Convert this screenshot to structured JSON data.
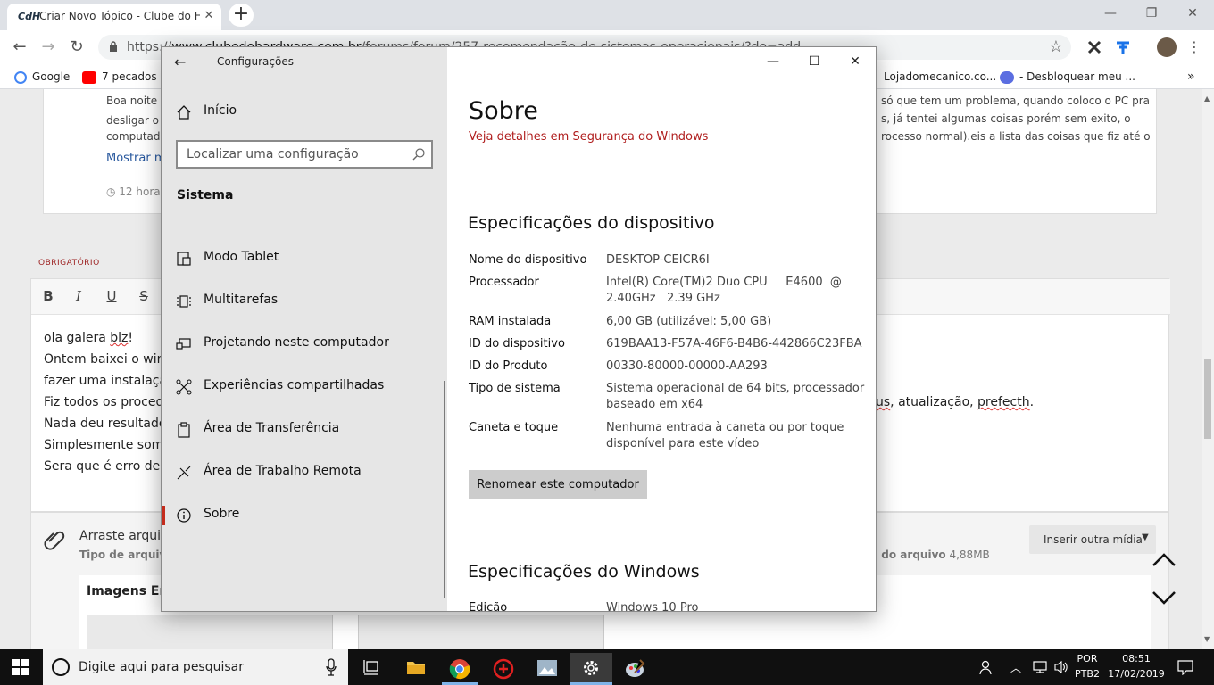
{
  "browser": {
    "tab_title": "Criar Novo Tópico - Clube do Ha",
    "tab_favicon_text": "CdH",
    "url_prefix": "https://",
    "url_domain": "www.clubedohardware.com.br",
    "url_path": "/forums/forum/257-recomendação-de-sistemas-operacionais/?do=add",
    "bookmarks": [
      {
        "label": "Google",
        "color": "#4285f4"
      },
      {
        "label": "7 pecados d",
        "color": "#ff0000"
      },
      {
        "label": "Lojadomecanico.co...",
        "color": "#e8e8e8"
      },
      {
        "label": "- Desbloquear meu ...",
        "color": "#5b6ee1"
      }
    ],
    "bookmarks_more": "»"
  },
  "page": {
    "post_line1": "Boa noite",
    "post_line2": "desligar o v",
    "post_line3": "computad",
    "post_right1": "só que tem um problema, quando coloco o PC pra",
    "post_right2": "s, já tentei algumas coisas porém sem exito, o",
    "post_right3": "rocesso normal).eis a lista das coisas que fiz até o",
    "show_more": "Mostrar ma",
    "time_ago": "12 horas",
    "required_label": "OBRIGATÓRIO",
    "format_buttons": [
      "B",
      "I",
      "U",
      "S"
    ],
    "editor_lines": [
      "ola galera ",
      "Ontem baixei o wind",
      "fazer uma instalaçã",
      "Fiz todos os procedi",
      "Nada deu resultado.",
      "Simplesmente some",
      "Sera que é erro des"
    ],
    "editor_word_blz": "blz",
    "editor_word_exclaim": "!",
    "editor_right_a": "us",
    "editor_right_b": ", atualização, ",
    "editor_right_c": "prefecth",
    "editor_right_d": ".",
    "attach_drag": "Arraste arquivo",
    "attach_types": "Tipo de arquiv",
    "attach_size_label": "l do arquivo",
    "attach_size_value": "4,88MB",
    "insert_media": "Inserir outra mídia",
    "images_heading": "Imagens Env"
  },
  "settings": {
    "app_title": "Configurações",
    "home": "Início",
    "search_placeholder": "Localizar uma configuração",
    "section": "Sistema",
    "nav": [
      {
        "label": "Modo Tablet",
        "icon": "tablet-mode-icon"
      },
      {
        "label": "Multitarefas",
        "icon": "multitasking-icon"
      },
      {
        "label": "Projetando neste computador",
        "icon": "projecting-icon"
      },
      {
        "label": "Experiências compartilhadas",
        "icon": "shared-experiences-icon"
      },
      {
        "label": "Área de Transferência",
        "icon": "clipboard-icon"
      },
      {
        "label": "Área de Trabalho Remota",
        "icon": "remote-desktop-icon"
      },
      {
        "label": "Sobre",
        "icon": "info-icon"
      }
    ],
    "accent": "#c42b1c",
    "about": {
      "title": "Sobre",
      "security_link": "Veja detalhes em Segurança do Windows",
      "device_specs_heading": "Especificações do dispositivo",
      "specs": [
        {
          "key": "Nome do dispositivo",
          "value": "DESKTOP-CEICR6I"
        },
        {
          "key": "Processador",
          "value": "Intel(R) Core(TM)2 Duo CPU     E4600  @ 2.40GHz   2.39 GHz"
        },
        {
          "key": "RAM instalada",
          "value": "6,00 GB (utilizável: 5,00 GB)"
        },
        {
          "key": "ID do dispositivo",
          "value": "619BAA13-F57A-46F6-B4B6-442866C23FBA"
        },
        {
          "key": "ID do Produto",
          "value": "00330-80000-00000-AA293"
        },
        {
          "key": "Tipo de sistema",
          "value": "Sistema operacional de 64 bits, processador baseado em x64"
        },
        {
          "key": "Caneta e toque",
          "value": "Nenhuma entrada à caneta ou por toque disponível para este vídeo"
        }
      ],
      "rename_button": "Renomear este computador",
      "windows_specs_heading": "Especificações do Windows",
      "edition_key": "Edição",
      "edition_value": "Windows 10 Pro"
    }
  },
  "taskbar": {
    "search_placeholder": "Digite aqui para pesquisar",
    "lang1": "POR",
    "lang2": "PTB2",
    "time": "08:51",
    "date": "17/02/2019"
  }
}
